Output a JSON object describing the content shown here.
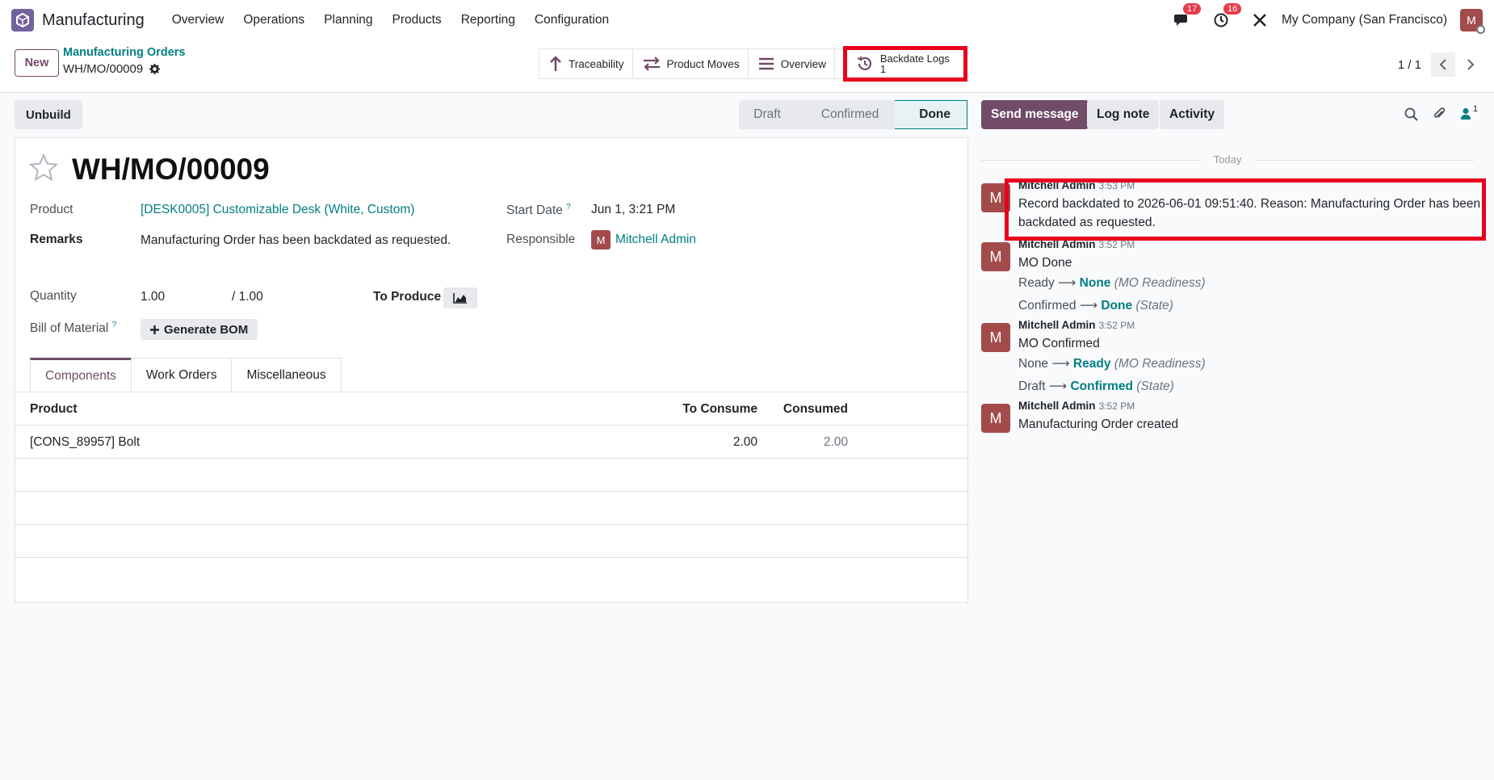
{
  "topbar": {
    "app_name": "Manufacturing",
    "menu": [
      "Overview",
      "Operations",
      "Planning",
      "Products",
      "Reporting",
      "Configuration"
    ],
    "messages_count": "17",
    "activities_count": "16",
    "company": "My Company (San Francisco)",
    "user_initial": "M"
  },
  "control": {
    "new_label": "New",
    "breadcrumb": "Manufacturing Orders",
    "record": "WH/MO/00009",
    "smart_buttons": {
      "traceability": "Traceability",
      "product_moves": "Product Moves",
      "overview": "Overview",
      "backdate_logs": "Backdate Logs",
      "backdate_count": "1"
    },
    "pager": "1 / 1"
  },
  "status": {
    "unbuild": "Unbuild",
    "stages": [
      "Draft",
      "Confirmed",
      "Done"
    ],
    "active_stage": "Done"
  },
  "form": {
    "title": "WH/MO/00009",
    "product_label": "Product",
    "product_value": "[DESK0005] Customizable Desk (White, Custom)",
    "remarks_label": "Remarks",
    "remarks_value": "Manufacturing Order has been backdated as requested.",
    "start_label": "Start Date",
    "start_value": "Jun 1, 3:21 PM",
    "responsible_label": "Responsible",
    "responsible_value": "Mitchell Admin",
    "responsible_initial": "M",
    "quantity_label": "Quantity",
    "quantity_value": "1.00",
    "quantity_total": "/ 1.00",
    "to_produce_label": "To Produce",
    "bom_label": "Bill of Material",
    "bom_button": "Generate BOM",
    "help_mark": "?"
  },
  "tabs": [
    "Components",
    "Work Orders",
    "Miscellaneous"
  ],
  "components": {
    "headers": {
      "product": "Product",
      "to_consume": "To Consume",
      "consumed": "Consumed"
    },
    "rows": [
      {
        "product": "[CONS_89957] Bolt",
        "to_consume": "2.00",
        "consumed": "2.00"
      }
    ]
  },
  "chatter": {
    "send_message": "Send message",
    "log_note": "Log note",
    "activity": "Activity",
    "followers": "1",
    "day_label": "Today",
    "messages": [
      {
        "initial": "M",
        "author": "Mitchell Admin",
        "time": "3:53 PM",
        "body": "Record backdated to 2026-06-01 09:51:40. Reason: Manufacturing Order has been backdated as requested."
      },
      {
        "initial": "M",
        "author": "Mitchell Admin",
        "time": "3:52 PM",
        "body": "MO Done",
        "t1_old": "Ready",
        "t1_new": "None",
        "t1_field": "(MO Readiness)",
        "t2_old": "Confirmed",
        "t2_new": "Done",
        "t2_field": "(State)"
      },
      {
        "initial": "M",
        "author": "Mitchell Admin",
        "time": "3:52 PM",
        "body": "MO Confirmed",
        "t1_old": "None",
        "t1_new": "Ready",
        "t1_field": "(MO Readiness)",
        "t2_old": "Draft",
        "t2_new": "Confirmed",
        "t2_field": "(State)"
      },
      {
        "initial": "M",
        "author": "Mitchell Admin",
        "time": "3:52 PM",
        "body": "Manufacturing Order created"
      }
    ]
  },
  "colors": {
    "brand": "#714b67",
    "link": "#017e84",
    "highlight": "#e8001c",
    "avatar": "#a34b4b"
  }
}
